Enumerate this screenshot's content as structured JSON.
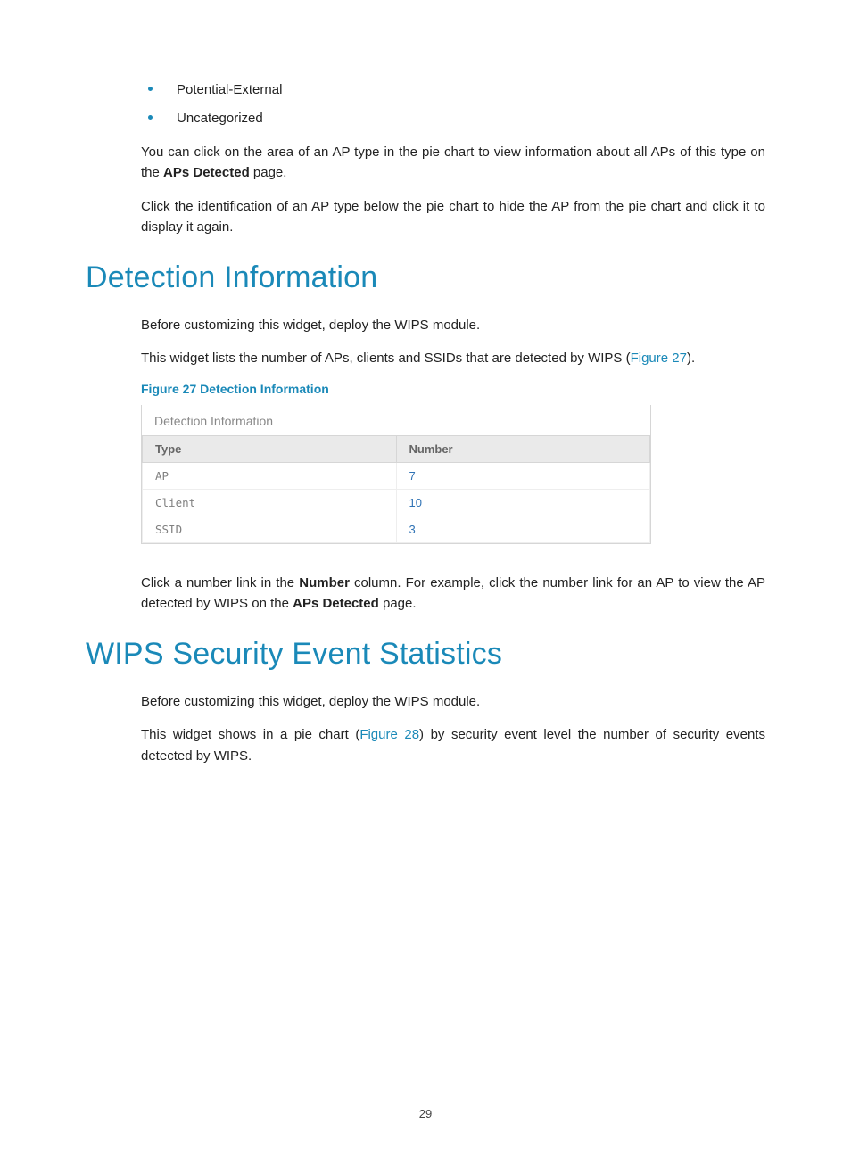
{
  "bullets": [
    "Potential-External",
    "Uncategorized"
  ],
  "intro_para_a": "You can click on the area of an AP type in the pie chart to view information about all APs of this type on the ",
  "intro_bold_a": "APs Detected",
  "intro_para_a_tail": " page.",
  "intro_para_b": "Click the identification of an AP type below the pie chart to hide the AP from the pie chart and click it to display it again.",
  "section1": {
    "heading": "Detection Information",
    "p1": "Before customizing this widget, deploy the WIPS module.",
    "p2a": "This widget lists the number of APs, clients and SSIDs that are detected by WIPS (",
    "p2link": "Figure 27",
    "p2b": ").",
    "caption": "Figure 27 Detection Information",
    "widget_title": "Detection Information",
    "table": {
      "headers": [
        "Type",
        "Number"
      ],
      "rows": [
        {
          "type": "AP",
          "number": "7"
        },
        {
          "type": "Client",
          "number": "10"
        },
        {
          "type": "SSID",
          "number": "3"
        }
      ]
    },
    "below_a": "Click a number link in the ",
    "below_bold1": "Number",
    "below_b": " column. For example, click the number link for an AP to view the AP detected by WIPS on the ",
    "below_bold2": "APs Detected",
    "below_c": " page."
  },
  "section2": {
    "heading": "WIPS Security Event Statistics",
    "p1": "Before customizing this widget, deploy the WIPS module.",
    "p2a": "This widget shows in a pie chart (",
    "p2link": "Figure 28",
    "p2b": ") by security event level the number of security events detected by WIPS."
  },
  "page_number": "29"
}
